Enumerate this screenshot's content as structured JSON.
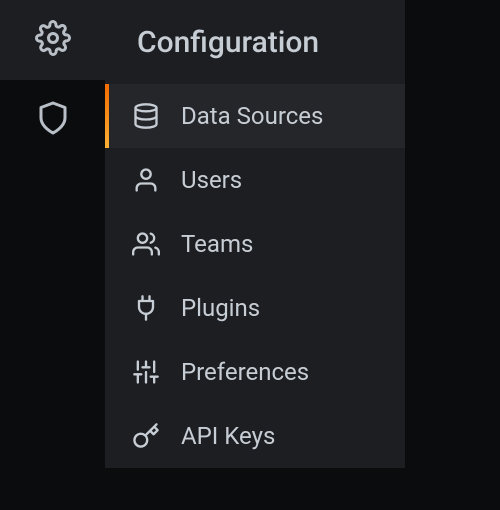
{
  "rail": {
    "items": [
      {
        "name": "gear-icon",
        "active": true
      },
      {
        "name": "shield-icon",
        "active": false
      }
    ]
  },
  "panel": {
    "title": "Configuration",
    "items": [
      {
        "icon": "database-icon",
        "label": "Data Sources",
        "active": true
      },
      {
        "icon": "user-icon",
        "label": "Users",
        "active": false
      },
      {
        "icon": "users-icon",
        "label": "Teams",
        "active": false
      },
      {
        "icon": "plug-icon",
        "label": "Plugins",
        "active": false
      },
      {
        "icon": "sliders-icon",
        "label": "Preferences",
        "active": false
      },
      {
        "icon": "key-icon",
        "label": "API Keys",
        "active": false
      }
    ]
  }
}
